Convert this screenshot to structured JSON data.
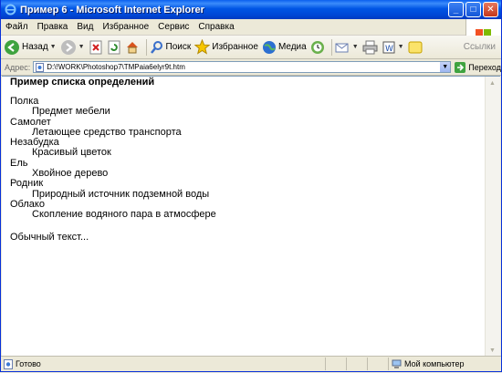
{
  "window": {
    "title": "Пример 6 - Microsoft Internet Explorer",
    "minimize_label": "_",
    "maximize_label": "□",
    "close_label": "✕"
  },
  "menu": [
    "Файл",
    "Правка",
    "Вид",
    "Избранное",
    "Сервис",
    "Справка"
  ],
  "toolbar": {
    "back_label": "Назад",
    "search_label": "Поиск",
    "favorites_label": "Избранное",
    "media_label": "Медиа",
    "links_label": "Ссылки"
  },
  "address": {
    "label": "Адрес:",
    "value": "D:\\!WORK\\Photoshop7\\TMPaia6elyr9t.htm",
    "go_label": "Переход"
  },
  "page": {
    "heading": "Пример списка определений",
    "definitions": [
      {
        "term": "Полка",
        "desc": "Предмет мебели"
      },
      {
        "term": "Самолет",
        "desc": "Летающее средство транспорта"
      },
      {
        "term": "Незабудка",
        "desc": "Красивый цветок"
      },
      {
        "term": "Ель",
        "desc": "Хвойное дерево"
      },
      {
        "term": "Родник",
        "desc": "Природный источник подземной воды"
      },
      {
        "term": "Облако",
        "desc": "Скопление водяного пара в атмосфере"
      }
    ],
    "plain_text": "Обычный текст..."
  },
  "status": {
    "text": "Готово",
    "zone": "Мой компьютер"
  },
  "colors": {
    "titlebar": "#0055E5",
    "chrome": "#ECE9D8",
    "content_bg": "#FFFFFF"
  }
}
